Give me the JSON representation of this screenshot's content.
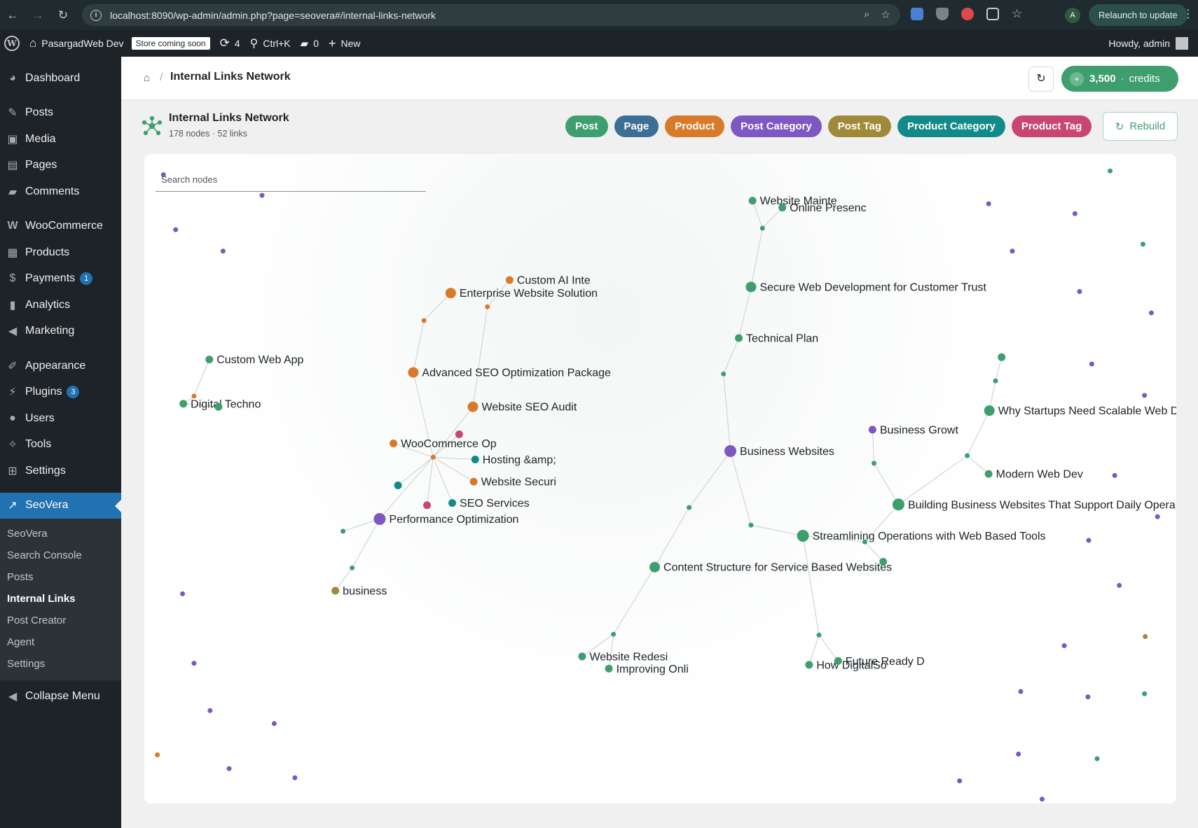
{
  "browser": {
    "url": "localhost:8090/wp-admin/admin.php?page=seovera#/internal-links-network",
    "profile_initial": "A",
    "relaunch_label": "Relaunch to update"
  },
  "admin_bar": {
    "site_name": "PasargadWeb Dev",
    "store_badge": "Store coming soon",
    "updates_count": "4",
    "search_shortcut": "Ctrl+K",
    "comments_count": "0",
    "new_label": "New",
    "howdy": "Howdy, admin"
  },
  "sidebar": {
    "items": [
      {
        "label": "Dashboard",
        "icon": "dashboard-icon"
      },
      {
        "label": "Posts",
        "icon": "pin-icon"
      },
      {
        "label": "Media",
        "icon": "media-icon"
      },
      {
        "label": "Pages",
        "icon": "pages-icon"
      },
      {
        "label": "Comments",
        "icon": "comment-icon"
      },
      {
        "label": "WooCommerce",
        "icon": "woo-icon"
      },
      {
        "label": "Products",
        "icon": "box-icon"
      },
      {
        "label": "Payments",
        "icon": "dollar-icon",
        "badge": "1"
      },
      {
        "label": "Analytics",
        "icon": "bar-chart-icon"
      },
      {
        "label": "Marketing",
        "icon": "megaphone-icon"
      },
      {
        "label": "Appearance",
        "icon": "brush-icon"
      },
      {
        "label": "Plugins",
        "icon": "plug-icon",
        "badge": "3"
      },
      {
        "label": "Users",
        "icon": "user-icon"
      },
      {
        "label": "Tools",
        "icon": "wrench-icon"
      },
      {
        "label": "Settings",
        "icon": "sliders-icon"
      },
      {
        "label": "SeoVera",
        "icon": "trend-icon"
      }
    ],
    "submenu": [
      "SeoVera",
      "Search Console",
      "Posts",
      "Internal Links",
      "Post Creator",
      "Agent",
      "Settings"
    ],
    "collapse_label": "Collapse Menu"
  },
  "header": {
    "title": "Internal Links Network",
    "credits_amount": "3,500",
    "credits_dot": "·",
    "credits_label": "credits"
  },
  "network": {
    "title": "Internal Links Network",
    "meta": "178 nodes · 52 links",
    "search_placeholder": "Search nodes",
    "rebuild_label": "Rebuild",
    "legend": [
      {
        "label": "Post",
        "color": "#3e9e6e"
      },
      {
        "label": "Page",
        "color": "#3d6e93"
      },
      {
        "label": "Product",
        "color": "#d97a2b"
      },
      {
        "label": "Post Category",
        "color": "#7e57c2"
      },
      {
        "label": "Post Tag",
        "color": "#a08a3a"
      },
      {
        "label": "Product Category",
        "color": "#138a8a"
      },
      {
        "label": "Product Tag",
        "color": "#c94670"
      }
    ]
  },
  "graph": {
    "colors": {
      "post": "#3e9e6e",
      "product": "#d97a2b",
      "post_category": "#7e57c2",
      "post_tag": "#a08a3a",
      "product_category": "#138a8a",
      "product_tag": "#c94670"
    },
    "labels": {
      "n1": "Website Mainte",
      "n2": "Online Presenc",
      "n4": "Secure Web Development for Customer Trust",
      "n5": "Technical Plan",
      "n7": "Business Websites",
      "n9": "Content Structure for Service Based Websites",
      "n11": "Website Redesi",
      "n12": "Improving Onli",
      "n14": "Streamlining Operations with Web Based Tools",
      "n16": "How DigitalSo",
      "n17": "Future Ready D",
      "n18": "Building Business Websites That Support Daily Opera",
      "n21": "Why Startups Need Scalable Web D",
      "n22": "Modern Web Dev",
      "n23": "Business Growt",
      "p1": "Custom AI Inte",
      "p2": "Enterprise Website Solution",
      "p4": "Advanced SEO Optimization Package",
      "p5": "Website SEO Audit",
      "p6": "WooCommerce Op",
      "p7": "Hosting &amp;",
      "p8": "Website Securi",
      "p9": "SEO Services",
      "p10": "Performance Optimization",
      "p12": "business",
      "c1": "Custom Web App",
      "c2": "Digital Techno"
    }
  }
}
